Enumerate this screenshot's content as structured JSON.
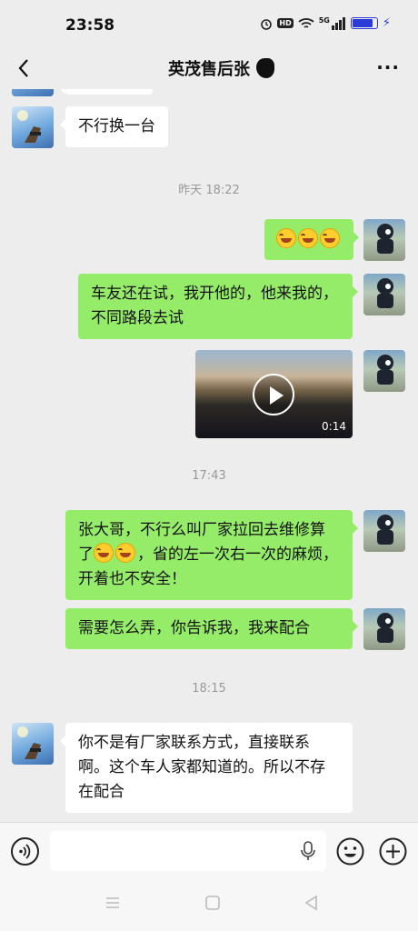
{
  "status_bar": {
    "time": "23:58",
    "hd": "HD",
    "signal": "5G"
  },
  "header": {
    "title": "英茂售后张"
  },
  "messages": [
    {
      "text": "不行换一台"
    },
    {
      "time": "昨天 18:22"
    },
    {
      "emoji_count": 3
    },
    {
      "text": "车友还在试，我开他的，他来我的，不同路段去试"
    },
    {
      "video_duration": "0:14"
    },
    {
      "time": "17:43"
    },
    {
      "text_before": "张大哥，不行么叫厂家拉回去维修算了",
      "text_after": "，省的左一次右一次的麻烦，开着也不安全！"
    },
    {
      "text": "需要怎么弄，你告诉我，我来配合"
    },
    {
      "time": "18:15"
    },
    {
      "text": "你不是有厂家联系方式，直接联系啊。这个车人家都知道的。所以不存在配合"
    }
  ],
  "input": {
    "placeholder": ""
  },
  "colors": {
    "sent_bubble": "#95ec69",
    "received_bubble": "#ffffff",
    "background": "#ededed"
  },
  "icons": [
    "back-icon",
    "more-icon",
    "voice-icon",
    "mic-icon",
    "emoji-icon",
    "plus-icon",
    "menu-icon",
    "home-icon",
    "back-triangle-icon"
  ]
}
